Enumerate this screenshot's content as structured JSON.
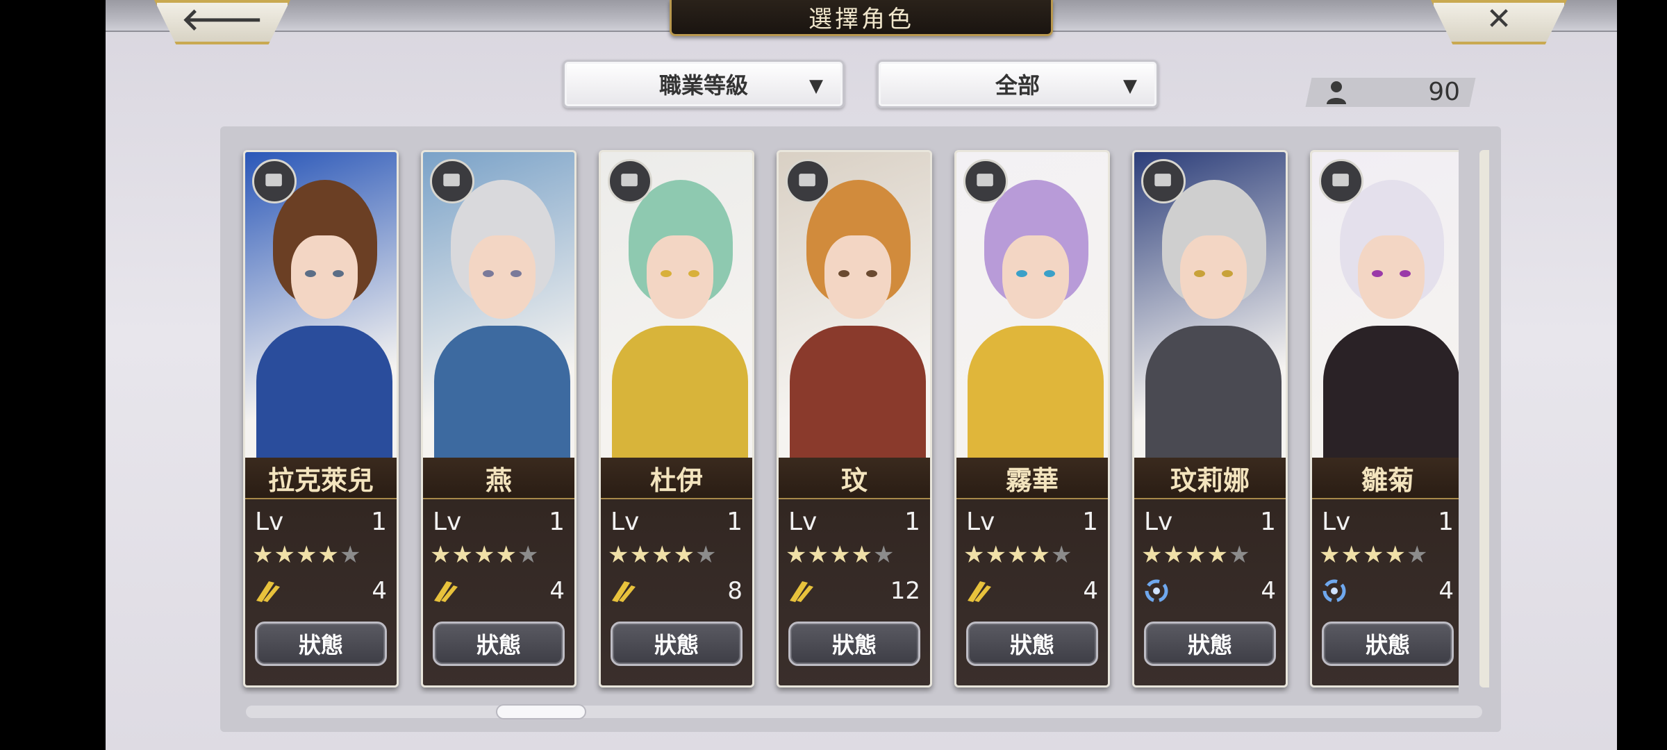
{
  "header": {
    "title": "選擇角色",
    "back_icon": "arrow-left-icon",
    "close_icon": "close-x-icon"
  },
  "filters": {
    "job_sort": {
      "value": "職業等級"
    },
    "scope": {
      "value": "全部"
    }
  },
  "roster_count": {
    "value": "90",
    "icon": "person-icon"
  },
  "cards": [
    {
      "name": "拉克萊兒",
      "lv_label": "Lv",
      "level": "1",
      "stars_filled": 4,
      "stars_total": 5,
      "element": "wind-icon",
      "count": "4",
      "button": "狀態",
      "class_icon": "bow-icon",
      "colors": {
        "hair": "#6b3f24",
        "outfit": "#2a4d9c",
        "bg": "#2a57b8",
        "eyes": "#5b6e86"
      }
    },
    {
      "name": "燕",
      "lv_label": "Lv",
      "level": "1",
      "stars_filled": 4,
      "stars_total": 5,
      "element": "wind-icon",
      "count": "4",
      "button": "狀態",
      "class_icon": "fist-icon",
      "colors": {
        "hair": "#d9d9dc",
        "outfit": "#3d6aa0",
        "bg": "#7aa2c8",
        "eyes": "#7a7a9a"
      }
    },
    {
      "name": "杜伊",
      "lv_label": "Lv",
      "level": "1",
      "stars_filled": 4,
      "stars_total": 5,
      "element": "wind-icon",
      "count": "8",
      "button": "狀態",
      "class_icon": "fist-icon",
      "colors": {
        "hair": "#8ec9b0",
        "outfit": "#d8b43a",
        "bg": "#ececea",
        "eyes": "#d8b03a"
      }
    },
    {
      "name": "玟",
      "lv_label": "Lv",
      "level": "1",
      "stars_filled": 4,
      "stars_total": 5,
      "element": "wind-icon",
      "count": "12",
      "button": "狀態",
      "class_icon": "hammer-icon",
      "colors": {
        "hair": "#d18b3c",
        "outfit": "#8a3a2c",
        "bg": "#d9d0c4",
        "eyes": "#6a4a30"
      }
    },
    {
      "name": "霧華",
      "lv_label": "Lv",
      "level": "1",
      "stars_filled": 4,
      "stars_total": 5,
      "element": "wind-icon",
      "count": "4",
      "button": "狀態",
      "class_icon": "hammer-icon",
      "colors": {
        "hair": "#b89bd8",
        "outfit": "#e0b63a",
        "bg": "#f3f1f4",
        "eyes": "#3aa0c8"
      }
    },
    {
      "name": "玟莉娜",
      "lv_label": "Lv",
      "level": "1",
      "stars_filled": 4,
      "stars_total": 5,
      "element": "water-icon",
      "count": "4",
      "button": "狀態",
      "class_icon": "hammer-icon",
      "colors": {
        "hair": "#cfcfcf",
        "outfit": "#4a4a52",
        "bg": "#2c3e7a",
        "eyes": "#c8a23a"
      }
    },
    {
      "name": "雛菊",
      "lv_label": "Lv",
      "level": "1",
      "stars_filled": 4,
      "stars_total": 5,
      "element": "water-icon",
      "count": "4",
      "button": "狀態",
      "class_icon": "hammer-icon",
      "colors": {
        "hair": "#e4e0ec",
        "outfit": "#2a2226",
        "bg": "#f1eef4",
        "eyes": "#9a3aa8"
      }
    }
  ]
}
